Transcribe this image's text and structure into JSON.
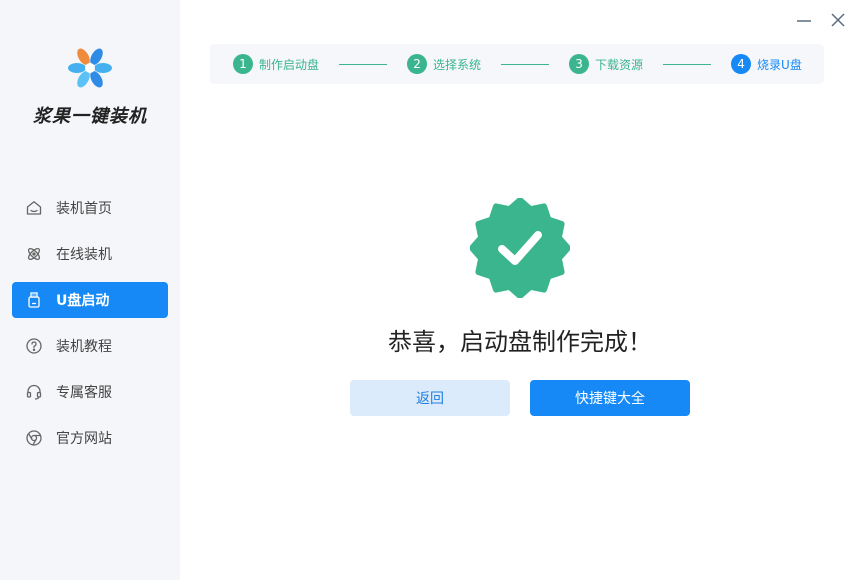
{
  "app": {
    "brand": "浆果一键装机"
  },
  "sidebar": {
    "items": [
      {
        "label": "装机首页",
        "icon": "home-icon",
        "active": false
      },
      {
        "label": "在线装机",
        "icon": "atom-icon",
        "active": false
      },
      {
        "label": "U盘启动",
        "icon": "usb-drive-icon",
        "active": true
      },
      {
        "label": "装机教程",
        "icon": "help-circle-icon",
        "active": false
      },
      {
        "label": "专属客服",
        "icon": "headset-icon",
        "active": false
      },
      {
        "label": "官方网站",
        "icon": "browser-globe-icon",
        "active": false
      }
    ]
  },
  "steps": [
    {
      "num": "1",
      "label": "制作启动盘",
      "state": "done"
    },
    {
      "num": "2",
      "label": "选择系统",
      "state": "done"
    },
    {
      "num": "3",
      "label": "下载资源",
      "state": "done"
    },
    {
      "num": "4",
      "label": "烧录U盘",
      "state": "current"
    }
  ],
  "main": {
    "message": "恭喜，启动盘制作完成！",
    "back_button": "返回",
    "hotkeys_button": "快捷键大全"
  },
  "window_controls": {
    "minimize_icon": "minimize-icon",
    "close_icon": "close-icon"
  },
  "colors": {
    "accent_blue": "#1689f6",
    "success_green": "#3bb58e",
    "sidebar_bg": "#f4f6f9"
  }
}
